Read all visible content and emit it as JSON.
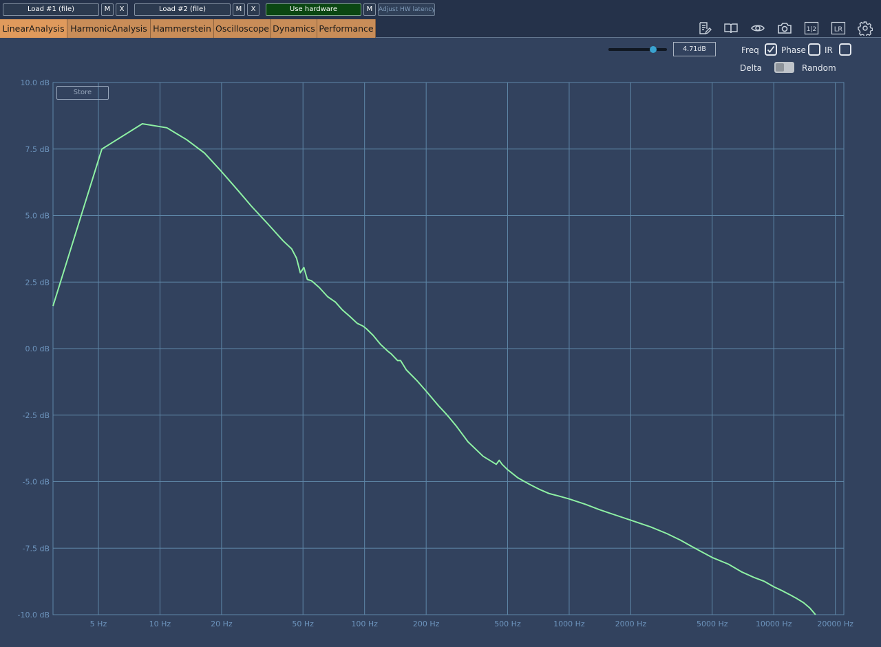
{
  "toolbar": {
    "load1_label": "Load #1 (file)",
    "load2_label": "Load #2 (file)",
    "m_label": "M",
    "x_label": "X",
    "use_hardware_label": "Use hardware",
    "adjust_latency_label": "Adjust HW latency"
  },
  "tabs": [
    {
      "label": "LinearAnalysis",
      "active": true
    },
    {
      "label": "HarmonicAnalysis",
      "active": false
    },
    {
      "label": "Hammerstein",
      "active": false
    },
    {
      "label": "Oscilloscope",
      "active": false
    },
    {
      "label": "Dynamics",
      "active": false
    },
    {
      "label": "Performance",
      "active": false
    }
  ],
  "tool_icons": [
    "notes-edit-icon",
    "book-icon",
    "eye-icon",
    "camera-icon",
    "half-icon",
    "lr-icon",
    "gear-icon"
  ],
  "tool_text": {
    "half": "1|2",
    "lr": "LR"
  },
  "controls": {
    "level_value": "4.71dB",
    "level_fraction": 0.77,
    "freq_label": "Freq",
    "freq_checked": true,
    "phase_label": "Phase",
    "phase_checked": false,
    "ir_label": "IR",
    "ir_checked": false,
    "delta_label": "Delta",
    "random_label": "Random",
    "delta_random_on": false
  },
  "store_label": "Store",
  "colors": {
    "background": "#32425e",
    "grid": "#5f87a8",
    "curve": "#8ef1a4",
    "tick_text": "#6d94bd",
    "tab": "#c98d58",
    "tab_active": "#e09a5c",
    "hardware_button": "#0b4712",
    "slider_thumb": "#3aa3d0"
  },
  "chart_data": {
    "type": "line",
    "xscale": "log",
    "xlim": [
      3,
      22000
    ],
    "ylim": [
      -10,
      10
    ],
    "ytick_values": [
      10,
      7.5,
      5,
      2.5,
      0,
      -2.5,
      -5,
      -7.5,
      -10
    ],
    "ytick_labels": [
      "10.0 dB",
      "7.5 dB",
      "5.0 dB",
      "2.5 dB",
      "0.0 dB",
      "-2.5 dB",
      "-5.0 dB",
      "-7.5 dB",
      "-10.0 dB"
    ],
    "xtick_values": [
      5,
      10,
      20,
      50,
      100,
      200,
      500,
      1000,
      2000,
      5000,
      10000,
      20000
    ],
    "xtick_labels": [
      "5 Hz",
      "10 Hz",
      "20 Hz",
      "50 Hz",
      "100 Hz",
      "200 Hz",
      "500 Hz",
      "1000 Hz",
      "2000 Hz",
      "5000 Hz",
      "10000 Hz",
      "20000 Hz"
    ],
    "grid": true,
    "series": [
      {
        "x": [
          3,
          5.2,
          8.2,
          10.8,
          13.5,
          16.5,
          20,
          24,
          28,
          34,
          40,
          44,
          46.5,
          48.5,
          50.5,
          52.5,
          55,
          60,
          66,
          72,
          78,
          85,
          92,
          98,
          102,
          110,
          120,
          130,
          135,
          145,
          150,
          160,
          180,
          200,
          230,
          250,
          260,
          280,
          320,
          380,
          440,
          455,
          470,
          500,
          560,
          640,
          720,
          800,
          900,
          1000,
          1200,
          1400,
          1600,
          2000,
          2500,
          3000,
          3500,
          4000,
          5000,
          6000,
          7000,
          8000,
          9000,
          10000,
          11000,
          12000,
          13000,
          14000,
          15000,
          16000
        ],
        "y": [
          1.6,
          7.5,
          8.45,
          8.3,
          7.85,
          7.35,
          6.65,
          5.95,
          5.35,
          4.65,
          4.05,
          3.75,
          3.4,
          2.85,
          3.05,
          2.6,
          2.55,
          2.3,
          1.95,
          1.75,
          1.45,
          1.2,
          0.95,
          0.85,
          0.75,
          0.5,
          0.15,
          -0.1,
          -0.2,
          -0.45,
          -0.45,
          -0.8,
          -1.2,
          -1.6,
          -2.15,
          -2.45,
          -2.6,
          -2.9,
          -3.5,
          -4.05,
          -4.35,
          -4.2,
          -4.35,
          -4.55,
          -4.85,
          -5.1,
          -5.3,
          -5.45,
          -5.55,
          -5.65,
          -5.85,
          -6.05,
          -6.2,
          -6.45,
          -6.7,
          -6.95,
          -7.2,
          -7.45,
          -7.85,
          -8.1,
          -8.4,
          -8.6,
          -8.75,
          -8.95,
          -9.1,
          -9.25,
          -9.4,
          -9.55,
          -9.75,
          -10
        ]
      }
    ]
  }
}
